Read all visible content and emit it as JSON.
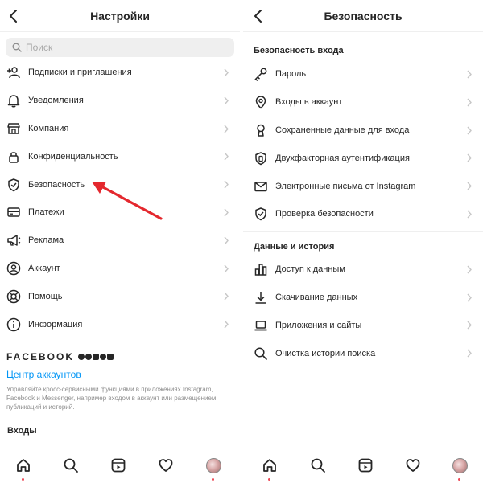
{
  "left": {
    "title": "Настройки",
    "search_placeholder": "Поиск",
    "items": [
      {
        "label": "Подписки и приглашения",
        "icon": "add-person-icon"
      },
      {
        "label": "Уведомления",
        "icon": "bell-icon"
      },
      {
        "label": "Компания",
        "icon": "shop-icon"
      },
      {
        "label": "Конфиденциальность",
        "icon": "lock-icon"
      },
      {
        "label": "Безопасность",
        "icon": "shield-check-icon"
      },
      {
        "label": "Платежи",
        "icon": "card-icon"
      },
      {
        "label": "Реклама",
        "icon": "megaphone-icon"
      },
      {
        "label": "Аккаунт",
        "icon": "account-icon"
      },
      {
        "label": "Помощь",
        "icon": "lifebuoy-icon"
      },
      {
        "label": "Информация",
        "icon": "info-icon"
      }
    ],
    "facebook": {
      "wordmark": "FACEBOOK",
      "accounts_center": "Центр аккаунтов",
      "description": "Управляйте кросс-сервисными функциями в приложениях Instagram, Facebook и Messenger, например входом в аккаунт или размещением публикаций и историй."
    },
    "logins_title": "Входы"
  },
  "right": {
    "title": "Безопасность",
    "section_login": "Безопасность входа",
    "login_items": [
      {
        "label": "Пароль",
        "icon": "key-icon"
      },
      {
        "label": "Входы в аккаунт",
        "icon": "location-pin-icon"
      },
      {
        "label": "Сохраненные данные для входа",
        "icon": "keyhole-icon"
      },
      {
        "label": "Двухфакторная аутентификация",
        "icon": "shield-phone-icon"
      },
      {
        "label": "Электронные письма от Instagram",
        "icon": "mail-icon"
      },
      {
        "label": "Проверка безопасности",
        "icon": "shield-check-icon"
      }
    ],
    "section_data": "Данные и история",
    "data_items": [
      {
        "label": "Доступ к данным",
        "icon": "bar-chart-icon"
      },
      {
        "label": "Скачивание данных",
        "icon": "download-icon"
      },
      {
        "label": "Приложения и сайты",
        "icon": "laptop-icon"
      },
      {
        "label": "Очистка истории поиска",
        "icon": "search-icon"
      }
    ]
  },
  "tabbar": [
    "home-icon",
    "search-icon",
    "reels-icon",
    "heart-icon",
    "profile-avatar"
  ],
  "colors": {
    "accent_link": "#0095f6",
    "arrow": "#e4282e",
    "notification_dot": "#ed4956"
  }
}
